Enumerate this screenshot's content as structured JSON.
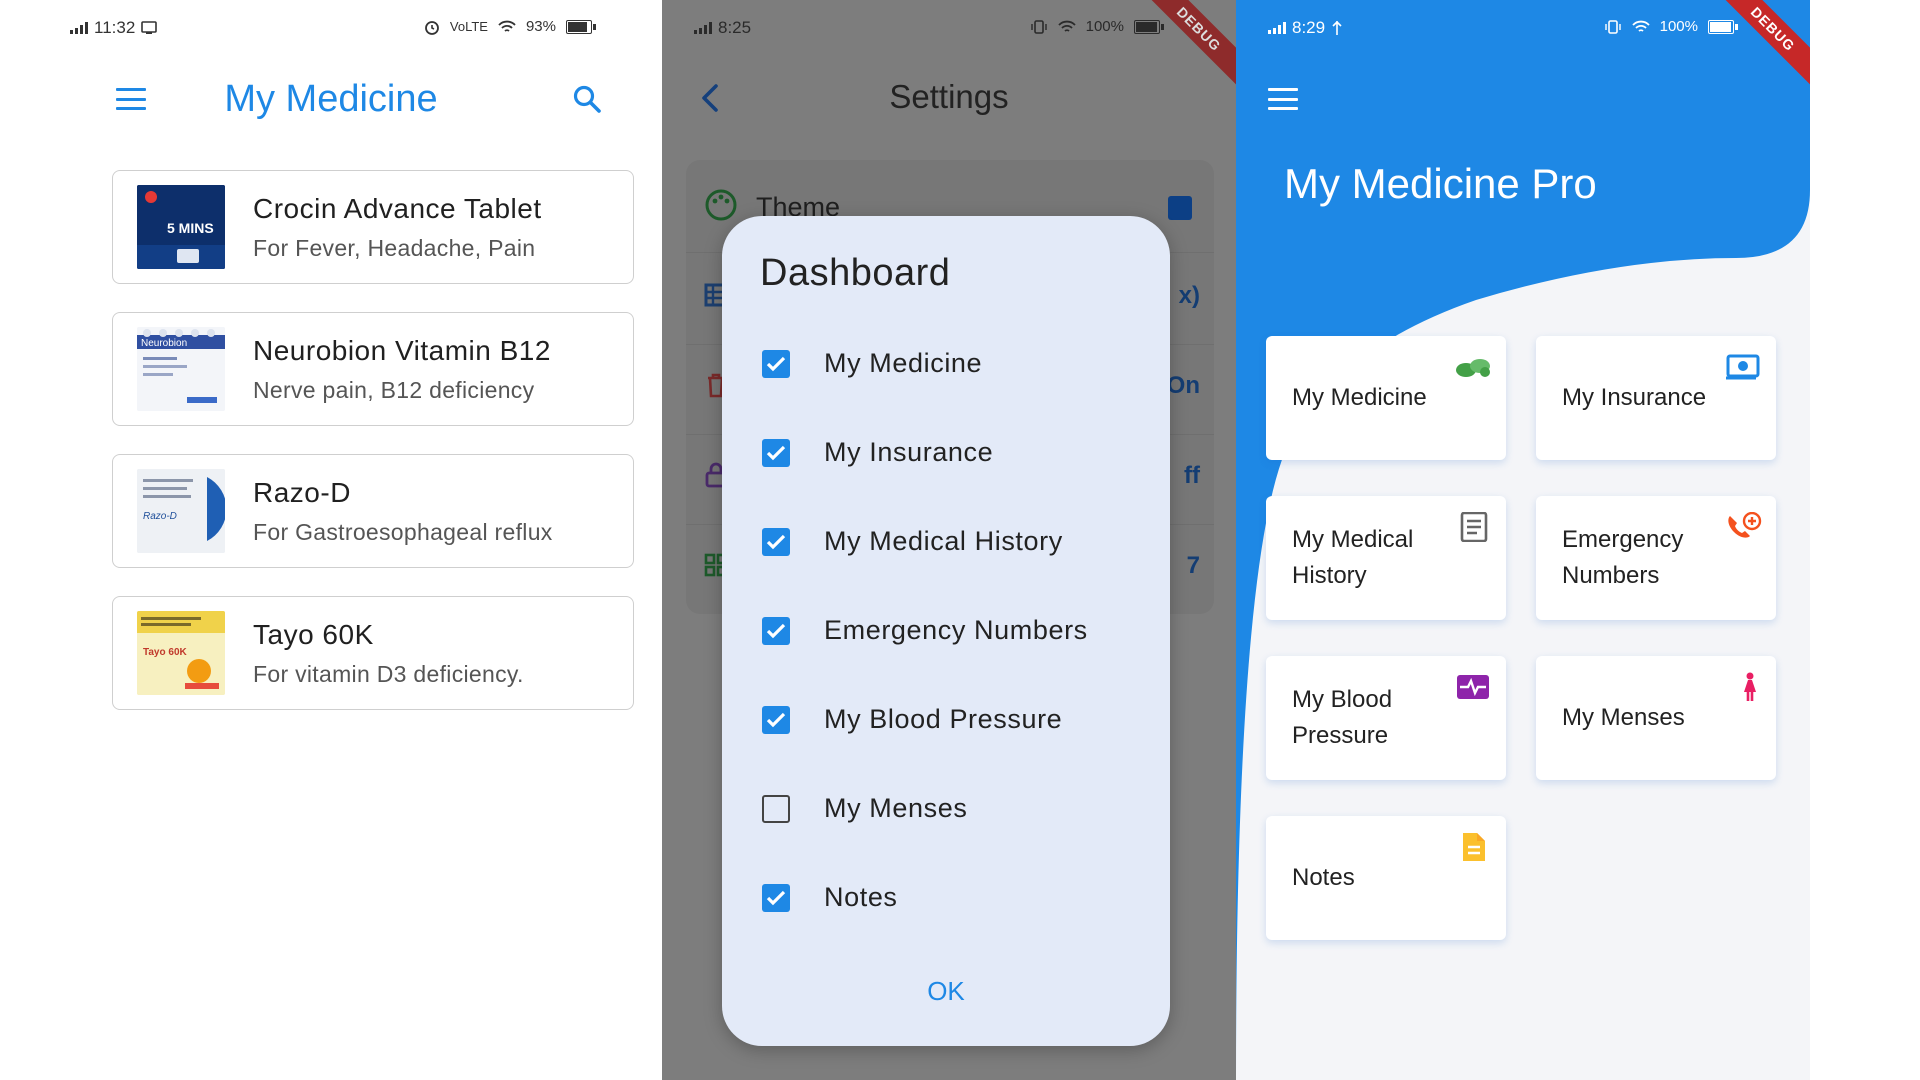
{
  "colors": {
    "accent": "#1e88e5",
    "overlay": "#7d7d7d",
    "dialog": "#e3eaf8",
    "debug": "#c62828"
  },
  "panel1": {
    "status": {
      "time": "11:32",
      "network": "VoLTE",
      "battery": "93%"
    },
    "title": "My Medicine",
    "icons": {
      "menu": "menu-icon",
      "search": "search-icon"
    },
    "medicines": [
      {
        "name": "Crocin Advance Tablet",
        "description": "For Fever, Headache, Pain",
        "pack_text": "5 MINS"
      },
      {
        "name": "Neurobion Vitamin B12",
        "description": "Nerve pain, B12 deficiency",
        "pack_text": "Neurobion"
      },
      {
        "name": "Razo-D",
        "description": "For Gastroesophageal reflux",
        "pack_text": "Razo-D"
      },
      {
        "name": "Tayo 60K",
        "description": "For vitamin D3 deficiency.",
        "pack_text": "Tayo 60K"
      }
    ]
  },
  "panel2": {
    "status": {
      "time": "8:25",
      "battery": "100%"
    },
    "debug_banner": "DEBUG",
    "title": "Settings",
    "settings": {
      "theme_label": "Theme",
      "theme_color": "#0c3f85",
      "rows": [
        {
          "value": "x)"
        },
        {
          "value": "On"
        },
        {
          "value": "ff"
        },
        {
          "value": "7"
        }
      ]
    },
    "dialog": {
      "title": "Dashboard",
      "items": [
        {
          "label": "My Medicine",
          "checked": true
        },
        {
          "label": "My Insurance",
          "checked": true
        },
        {
          "label": "My Medical History",
          "checked": true
        },
        {
          "label": "Emergency Numbers",
          "checked": true
        },
        {
          "label": "My Blood Pressure",
          "checked": true
        },
        {
          "label": "My Menses",
          "checked": false
        },
        {
          "label": "Notes",
          "checked": true
        }
      ],
      "ok_label": "OK"
    }
  },
  "panel3": {
    "status": {
      "time": "8:29",
      "battery": "100%"
    },
    "debug_banner": "DEBUG",
    "title": "My Medicine Pro",
    "tiles": [
      {
        "label": "My Medicine",
        "icon": "pills-icon",
        "color": "#43a047"
      },
      {
        "label": "My Insurance",
        "icon": "insurance-card-icon",
        "color": "#1e88e5"
      },
      {
        "label": "My Medical History",
        "icon": "document-icon",
        "color": "#666666"
      },
      {
        "label": "Emergency Numbers",
        "icon": "emergency-phone-icon",
        "color": "#f4511e"
      },
      {
        "label": "My Blood Pressure",
        "icon": "pulse-icon",
        "color": "#8e24aa"
      },
      {
        "label": "My Menses",
        "icon": "woman-icon",
        "color": "#e91e63"
      },
      {
        "label": "Notes",
        "icon": "note-icon",
        "color": "#fbc02d"
      }
    ]
  }
}
